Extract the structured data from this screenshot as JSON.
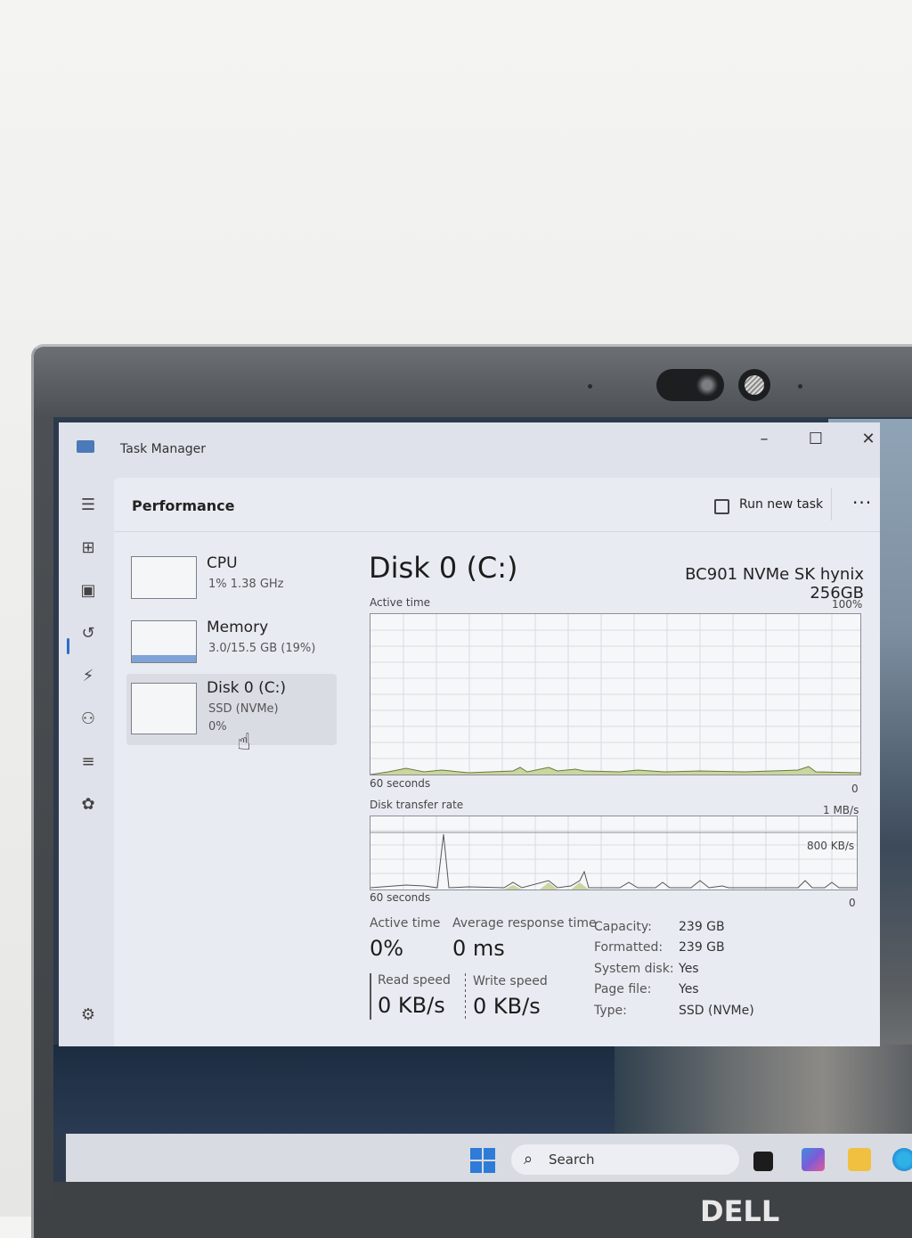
{
  "window": {
    "title": "Task Manager",
    "controls": {
      "minimize": "–",
      "maximize": "☐",
      "close": "✕"
    }
  },
  "header": {
    "title": "Performance",
    "run_new_task": "Run new task",
    "more": "···"
  },
  "resources": [
    {
      "name": "CPU",
      "sub": "1% 1.38 GHz",
      "sub2": ""
    },
    {
      "name": "Memory",
      "sub": "3.0/15.5 GB (19%)",
      "sub2": ""
    },
    {
      "name": "Disk 0 (C:)",
      "sub": "SSD (NVMe)",
      "sub2": "0%"
    }
  ],
  "detail": {
    "title": "Disk 0 (C:)",
    "model": "BC901 NVMe SK hynix 256GB",
    "active_time_graph": {
      "label": "Active time",
      "max": "100%",
      "x_label": "60 seconds",
      "min": "0"
    },
    "transfer_graph": {
      "label": "Disk transfer rate",
      "max": "1 MB/s",
      "mid": "800 KB/s",
      "x_label": "60 seconds",
      "min": "0"
    },
    "stats": {
      "active_time_label": "Active time",
      "active_time_value": "0%",
      "avg_response_label": "Average response time",
      "avg_response_value": "0 ms",
      "read_label": "Read speed",
      "read_value": "0 KB/s",
      "write_label": "Write speed",
      "write_value": "0 KB/s"
    },
    "properties": [
      {
        "key": "Capacity:",
        "value": "239 GB"
      },
      {
        "key": "Formatted:",
        "value": "239 GB"
      },
      {
        "key": "System disk:",
        "value": "Yes"
      },
      {
        "key": "Page file:",
        "value": "Yes"
      },
      {
        "key": "Type:",
        "value": "SSD (NVMe)"
      }
    ]
  },
  "taskbar": {
    "search_label": "Search"
  },
  "brand": "DELL",
  "accent": "#2f6bc9"
}
